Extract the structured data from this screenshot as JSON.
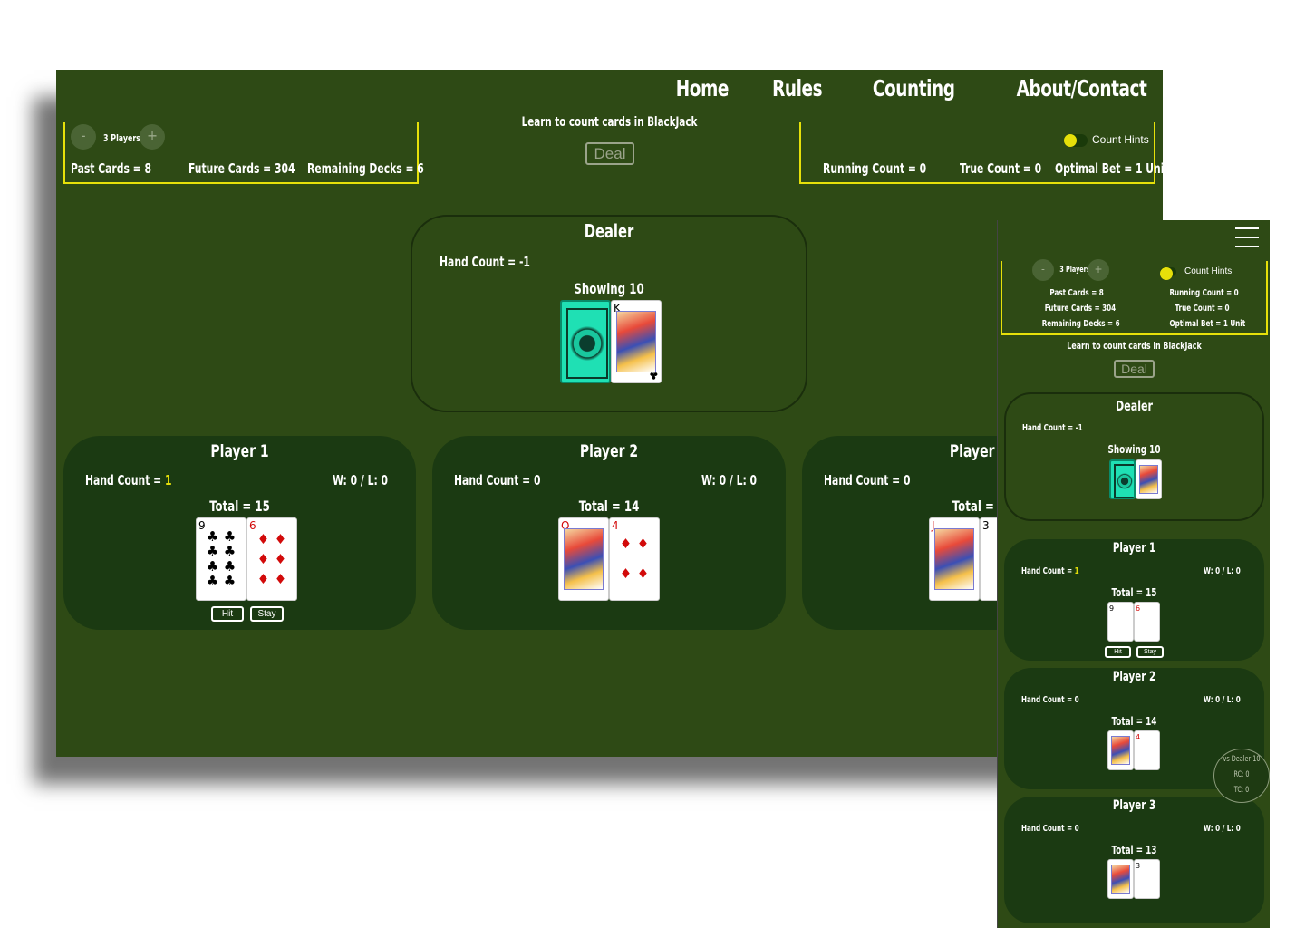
{
  "nav": {
    "items": [
      "Home",
      "Rules",
      "Counting",
      "About/Contact"
    ]
  },
  "controls": {
    "minus": "-",
    "plus": "+",
    "players_label": "3 Players",
    "tagline": "Learn to count cards in BlackJack",
    "deal": "Deal",
    "count_hints": "Count Hints"
  },
  "stats": {
    "past_cards": "Past Cards = 8",
    "future_cards": "Future Cards = 304",
    "remaining_decks": "Remaining Decks = 6",
    "running_count": "Running Count = 0",
    "true_count": "True Count = 0",
    "optimal_bet": "Optimal Bet = 1 Unit"
  },
  "dealer": {
    "title": "Dealer",
    "hand_count_label": "Hand Count =",
    "hand_count": "-1",
    "showing": "Showing 10",
    "card_rank": "K",
    "card_suit": "♣"
  },
  "players": [
    {
      "title": "Player 1",
      "hand_count_label": "Hand Count =",
      "hand_count": "1",
      "record": "W: 0 / L: 0",
      "total": "Total = 15",
      "cards": [
        {
          "rank": "9",
          "suit": "♣",
          "color": "black"
        },
        {
          "rank": "6",
          "suit": "♦",
          "color": "red"
        }
      ],
      "hit": "Hit",
      "stay": "Stay"
    },
    {
      "title": "Player 2",
      "hand_count_label": "Hand Count =",
      "hand_count": "0",
      "record": "W: 0 / L: 0",
      "total": "Total = 14",
      "cards": [
        {
          "rank": "Q",
          "suit": "♥",
          "color": "red"
        },
        {
          "rank": "4",
          "suit": "♦",
          "color": "red"
        }
      ]
    },
    {
      "title": "Player 3",
      "hand_count_label": "Hand Count =",
      "hand_count": "0",
      "record": "W: 0 / L: 0",
      "total": "Total = 13",
      "cards": [
        {
          "rank": "J",
          "suit": "♦",
          "color": "red"
        },
        {
          "rank": "3",
          "suit": "♠",
          "color": "black"
        }
      ]
    }
  ],
  "desktop_partial": {
    "player3_title": "Player 3",
    "player3_total": "Total = 1"
  },
  "hint_bubble": {
    "line1": "vs Dealer 10",
    "line2": "RC: 0",
    "line3": "TC: 0"
  },
  "colors": {
    "felt": "#2e4a15",
    "pod": "#1b3a12",
    "accent": "#e6e00a",
    "card_back": "#1fe0b4"
  }
}
